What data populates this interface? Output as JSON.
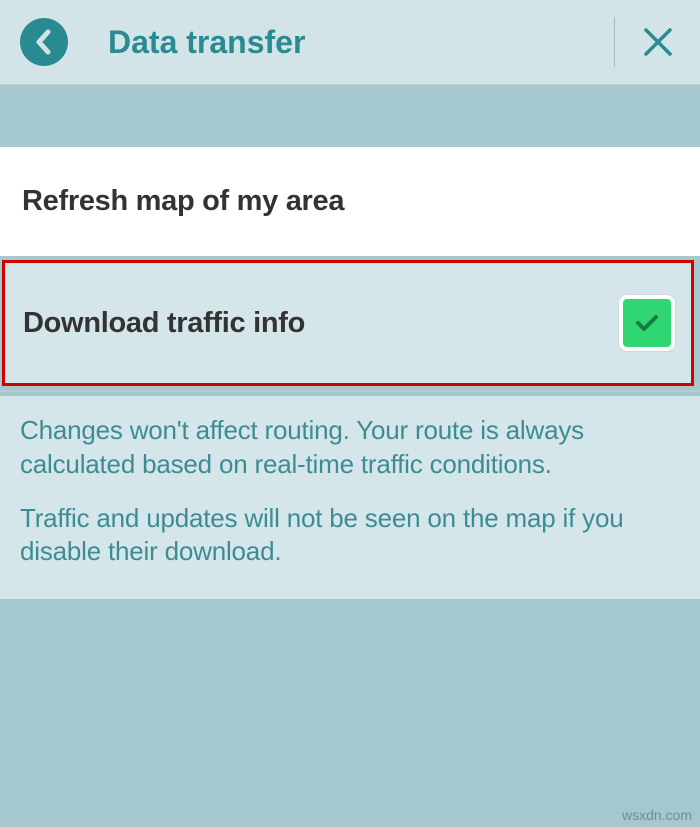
{
  "header": {
    "title": "Data transfer"
  },
  "rows": {
    "refresh_label": "Refresh map of my area",
    "download_label": "Download traffic info"
  },
  "info": {
    "p1": "Changes won't affect routing. Your route is always calculated based on real-time traffic conditions.",
    "p2": "Traffic and updates will not be seen on the map if you disable their download."
  },
  "watermark": "wsxdn.com"
}
